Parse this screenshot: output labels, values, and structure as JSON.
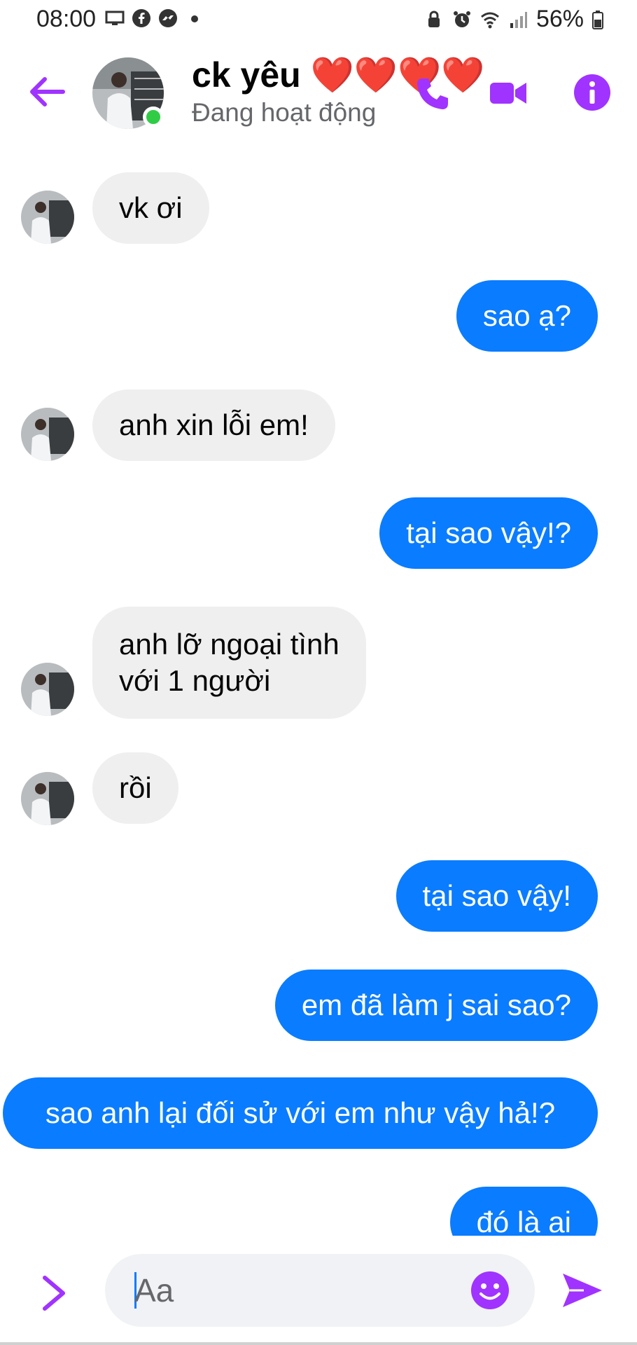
{
  "status_bar": {
    "time": "08:00",
    "left_icons": [
      "screen-icon",
      "facebook-icon",
      "messenger-icon",
      "dot-icon"
    ],
    "right_icons": [
      "lock-icon",
      "alarm-icon",
      "wifi-icon",
      "signal-icon",
      "battery-icon"
    ],
    "battery": "56%"
  },
  "header": {
    "name": "ck yêu ❤️❤️❤️❤️",
    "status": "Đang hoạt động",
    "online": true
  },
  "messages": [
    {
      "side": "in",
      "text": "vk ơi"
    },
    {
      "side": "out",
      "text": "sao ạ?"
    },
    {
      "side": "in",
      "text": "anh xin lỗi em!"
    },
    {
      "side": "out",
      "text": "tại sao vậy!?"
    },
    {
      "side": "in",
      "text": "anh lỡ ngoại tình\nvới 1 người"
    },
    {
      "side": "in",
      "text": "rồi"
    },
    {
      "side": "out",
      "text": "tại sao vậy!"
    },
    {
      "side": "out",
      "text": "em đã làm j sai sao?"
    },
    {
      "side": "out",
      "text": "sao anh lại đối sử với em như vậy hả!?"
    },
    {
      "side": "out",
      "text": "đó là ai"
    }
  ],
  "composer": {
    "placeholder": "Aa"
  },
  "colors": {
    "accent": "#a033ff",
    "outgoing_bubble": "#0a7cff",
    "incoming_bubble": "#efefef",
    "online": "#31cc46"
  }
}
